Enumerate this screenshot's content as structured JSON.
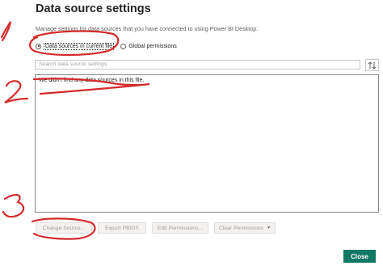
{
  "dialog": {
    "title": "Data source settings",
    "description": "Manage settings for data sources that you have connected to using Power BI Desktop.",
    "scope_options": [
      {
        "label": "Data sources in current file",
        "selected": true
      },
      {
        "label": "Global permissions",
        "selected": false
      }
    ],
    "search": {
      "placeholder": "Search data source settings"
    },
    "empty_message": "We didn't find any data sources in this file.",
    "buttons": {
      "change_source": "Change Source...",
      "export_pbids": "Export PBIDS",
      "edit_permissions": "Edit Permissions...",
      "clear_permissions": "Clear Permissions"
    },
    "close_label": "Close",
    "accent_color": "#117865"
  },
  "annotations": {
    "color": "#d42a2a",
    "numbers": [
      "1",
      "2",
      "3"
    ]
  }
}
